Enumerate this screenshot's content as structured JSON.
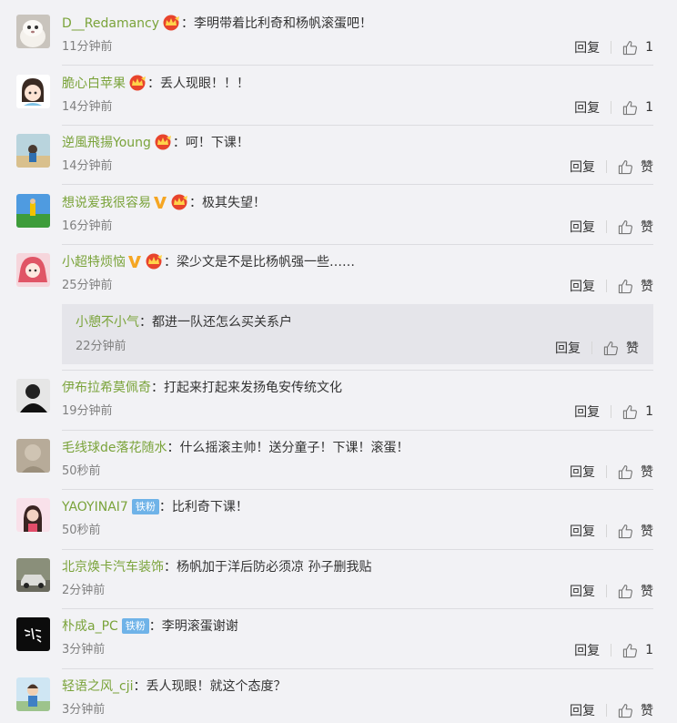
{
  "labels": {
    "reply": "回复",
    "praise": "赞"
  },
  "colors": {
    "username": "#7aa33a",
    "badge_crown": "#e8442c",
    "badge_vip": "#f5a623",
    "fan_badge": "#6fb3e8"
  },
  "comments": [
    {
      "username": "D__Redamancy",
      "crown": true,
      "vip": false,
      "fan": "",
      "text": "：李明带着比利奇和杨帆滚蛋吧！",
      "time": "11分钟前",
      "reply": "回复",
      "like": "1",
      "avatar": "cat"
    },
    {
      "username": "脆心白苹果",
      "crown": true,
      "vip": false,
      "fan": "",
      "text": "：丢人现眼！！！",
      "time": "14分钟前",
      "reply": "回复",
      "like": "1",
      "avatar": "girl"
    },
    {
      "username": "逆風飛揚Young",
      "crown": true,
      "vip": false,
      "fan": "",
      "text": "：呵！下课！",
      "time": "14分钟前",
      "reply": "回复",
      "like": "赞",
      "avatar": "sky"
    },
    {
      "username": "想说爱我很容易",
      "crown": true,
      "vip": true,
      "fan": "",
      "text": "：极其失望！",
      "time": "16分钟前",
      "reply": "回复",
      "like": "赞",
      "avatar": "field"
    },
    {
      "username": "小超特烦恼",
      "crown": true,
      "vip": true,
      "fan": "",
      "text": "：梁少文是不是比杨帆强一些……",
      "time": "25分钟前",
      "reply": "回复",
      "like": "赞",
      "avatar": "anime"
    },
    {
      "username": "伊布拉希莫佩奇",
      "crown": false,
      "vip": false,
      "fan": "",
      "text": "：打起来打起来发扬龟安传统文化",
      "time": "19分钟前",
      "reply": "回复",
      "like": "1",
      "avatar": "bw"
    },
    {
      "username": "毛线球de落花随水",
      "crown": false,
      "vip": false,
      "fan": "",
      "text": "：什么摇滚主帅！送分童子！下课！滚蛋！",
      "time": "50秒前",
      "reply": "回复",
      "like": "赞",
      "avatar": "sketch"
    },
    {
      "username": "YAOYINAI7",
      "crown": false,
      "vip": false,
      "fan": "铁粉",
      "text": "：比利奇下课！",
      "time": "50秒前",
      "reply": "回复",
      "like": "赞",
      "avatar": "pink"
    },
    {
      "username": "北京焕卡汽车装饰",
      "crown": false,
      "vip": false,
      "fan": "",
      "text": "：杨帆加于洋后防必须凉 孙子删我贴",
      "time": "2分钟前",
      "reply": "回复",
      "like": "赞",
      "avatar": "car"
    },
    {
      "username": "朴成a_PC",
      "crown": false,
      "vip": false,
      "fan": "铁粉",
      "text": "：李明滚蛋谢谢",
      "time": "3分钟前",
      "reply": "回复",
      "like": "1",
      "avatar": "black"
    },
    {
      "username": "轻语之风_cji",
      "crown": false,
      "vip": false,
      "fan": "",
      "text": "：丢人现眼！就这个态度？",
      "time": "3分钟前",
      "reply": "回复",
      "like": "赞",
      "avatar": "kid"
    }
  ],
  "sub_reply": {
    "username": "小憩不小气",
    "text": "：都进一队还怎么买关系户",
    "time": "22分钟前",
    "reply": "回复",
    "like": "赞"
  }
}
